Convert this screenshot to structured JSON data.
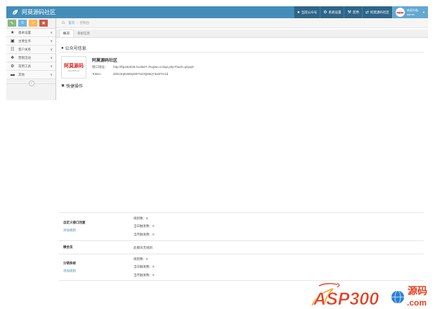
{
  "app": {
    "brand": "阿莫源码社区"
  },
  "topnav": {
    "items": [
      {
        "icon": "user-icon",
        "label": "当前公众号"
      },
      {
        "icon": "gear-icon",
        "label": "系统设置"
      },
      {
        "icon": "wrench-icon",
        "label": "禁用"
      },
      {
        "icon": "swap-icon",
        "label": "阿莫源码社区"
      }
    ],
    "user": {
      "welcome": "欢迎光临,",
      "name": "admin"
    }
  },
  "shortcuts": [
    {
      "icon": "pencil-icon",
      "color": "#87b87f"
    },
    {
      "icon": "list-icon",
      "color": "#6fb3e0"
    },
    {
      "icon": "group-icon",
      "color": "#ffb752"
    },
    {
      "icon": "trash-icon",
      "color": "#d15b47"
    }
  ],
  "sidebar": {
    "items": [
      {
        "icon": "star-icon",
        "label": "基本设置"
      },
      {
        "icon": "briefcase-icon",
        "label": "主要业务"
      },
      {
        "icon": "sitemap-icon",
        "label": "客户关系"
      },
      {
        "icon": "gift-icon",
        "label": "营销活动"
      },
      {
        "icon": "cog-icon",
        "label": "常用工具"
      },
      {
        "icon": "folder-icon",
        "label": "其他"
      }
    ]
  },
  "breadcrumb": {
    "home": "首页",
    "current": "控制台"
  },
  "tabs": [
    {
      "label": "概况"
    },
    {
      "label": "系统信息"
    }
  ],
  "account_section": {
    "title": "公众号信息"
  },
  "account": {
    "logo_text": "阿莫源码",
    "logo_sub": "www.2345.com",
    "name": "阿莫源码社区",
    "api_label": "接口地址：",
    "api_url": "http://ftp192029.host507.zhujiwu.cn/api.php?hash=p6yqD",
    "token_label": "Token：",
    "token": "d25z3q5s565y66Y523Q66qY3w6YU1d"
  },
  "quick_section": {
    "title": "快捷操作"
  },
  "stats": {
    "custom_reply": {
      "label": "自定义接口回复",
      "link": "添加规则",
      "lines": [
        "规则数：0",
        "当日触发数：0",
        "当月触发数：0"
      ]
    },
    "wecard": {
      "label": "微会员",
      "note": "此模块无规则"
    },
    "distribution": {
      "label": "分销系统",
      "link": "添加规则",
      "lines": [
        "规则数：0",
        "当日触发数：0",
        "当月触发数：0"
      ]
    }
  },
  "watermark": {
    "text": "ASP300",
    "cn": "源码",
    "domain": ".com"
  }
}
